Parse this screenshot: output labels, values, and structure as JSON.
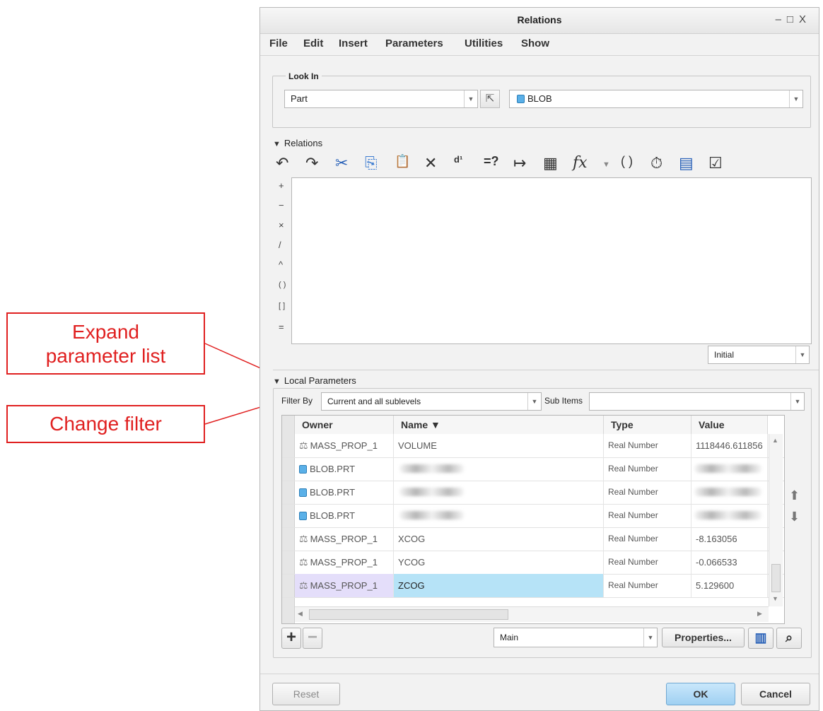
{
  "annotations": {
    "expand_list": [
      "Expand",
      "parameter list"
    ],
    "change_filter": "Change filter"
  },
  "window": {
    "title": "Relations",
    "controls": [
      "–",
      "□",
      "X"
    ]
  },
  "menu": [
    "File",
    "Edit",
    "Insert",
    "Parameters",
    "Utilities",
    "Show"
  ],
  "look_in": {
    "label": "Look In",
    "type_value": "Part",
    "object_value": "BLOB"
  },
  "relations": {
    "label": "Relations",
    "operators": [
      "+",
      "−",
      "×",
      "/",
      "^",
      "( )",
      "[ ]",
      "="
    ],
    "mode_value": "Initial",
    "toolbar_icons": [
      "undo-icon",
      "redo-icon",
      "cut-icon",
      "copy-icon",
      "paste-icon",
      "delete-icon",
      "switch-dimensions-icon",
      "evaluate-icon",
      "insert-dimension-icon",
      "insert-parameter-icon",
      "function-icon",
      "parentheses-icon",
      "verify-icon",
      "display-icon",
      "check-icon"
    ],
    "toolbar_glyphs": [
      "↶",
      "↷",
      "✂",
      "⎘",
      "📋",
      "✕",
      "d¹",
      "=?",
      "↦",
      "▦",
      "fx",
      "( )",
      "⏱",
      "▤",
      "☑"
    ]
  },
  "local_params": {
    "label": "Local Parameters",
    "filter_label": "Filter By",
    "filter_value": "Current and all sublevels",
    "subitems_label": "Sub Items",
    "subitems_value": "",
    "columns": [
      "Owner",
      "Name ▼",
      "Type",
      "Value"
    ],
    "rows": [
      {
        "owner": "MASS_PROP_1",
        "name": "VOLUME",
        "type": "Real Number",
        "value": "1118446.611856",
        "icon": "mass"
      },
      {
        "owner": "BLOB.PRT",
        "name": "",
        "type": "Real Number",
        "value": "",
        "icon": "part"
      },
      {
        "owner": "BLOB.PRT",
        "name": "",
        "type": "Real Number",
        "value": "",
        "icon": "part"
      },
      {
        "owner": "BLOB.PRT",
        "name": "",
        "type": "Real Number",
        "value": "",
        "icon": "part"
      },
      {
        "owner": "MASS_PROP_1",
        "name": "XCOG",
        "type": "Real Number",
        "value": "-8.163056",
        "icon": "mass"
      },
      {
        "owner": "MASS_PROP_1",
        "name": "YCOG",
        "type": "Real Number",
        "value": "-0.066533",
        "icon": "mass"
      },
      {
        "owner": "MASS_PROP_1",
        "name": "ZCOG",
        "type": "Real Number",
        "value": "5.129600",
        "icon": "mass"
      }
    ],
    "selected_row": 6,
    "add": "+",
    "remove": "−",
    "view_value": "Main",
    "properties": "Properties..."
  },
  "footer": {
    "reset": "Reset",
    "ok": "OK",
    "cancel": "Cancel"
  },
  "colors": {
    "callout": "#e02020",
    "selected": "#b6e3f7",
    "ok_button": "#a9d6f5"
  }
}
